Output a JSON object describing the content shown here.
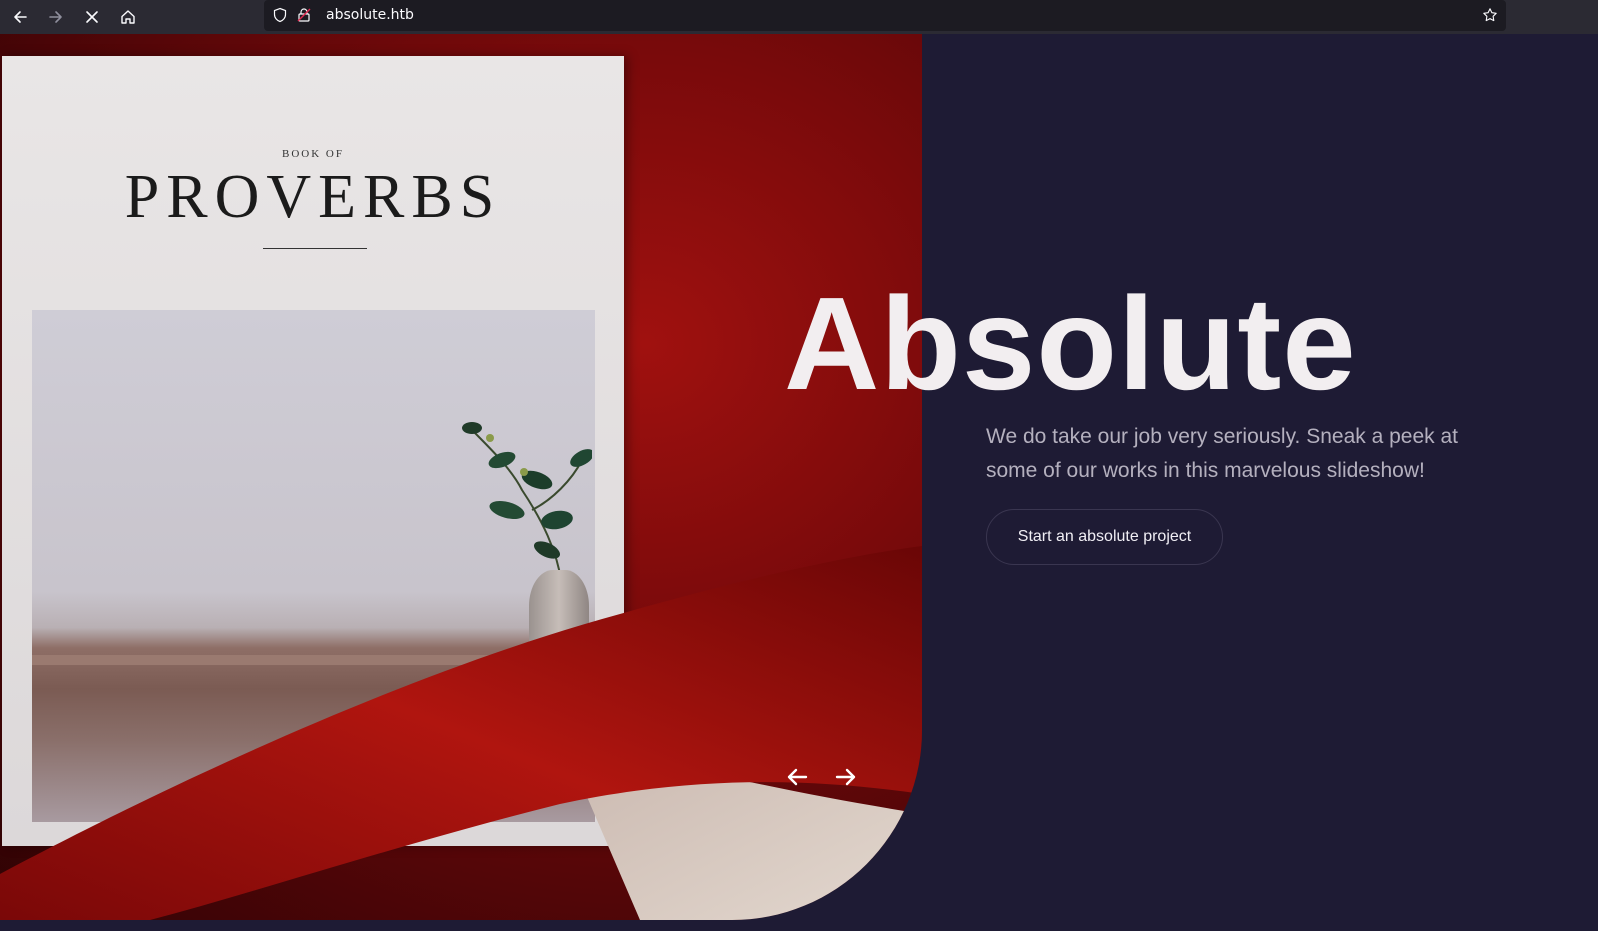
{
  "browser": {
    "url": "absolute.htb",
    "icons": [
      "back-arrow-icon",
      "forward-arrow-icon",
      "stop-icon",
      "home-icon",
      "shield-icon",
      "insecure-lock-icon",
      "bookmark-star-icon"
    ]
  },
  "hero": {
    "title": "Absolute",
    "subtitle": "We do take our job very seriously. Sneak a peek at some of our works in this marvelous slideshow!",
    "cta_label": "Start an absolute project",
    "image": {
      "book_label_small": "BOOK OF",
      "book_label_large": "PROVERBS"
    }
  },
  "slider": {
    "prev_icon": "arrow-left-icon",
    "next_icon": "arrow-right-icon"
  },
  "colors": {
    "page_bg": "#1e1b34",
    "hero_red": "#8f0d0c",
    "title_text": "#f2eef0",
    "subtitle_text": "#b4b0be"
  }
}
